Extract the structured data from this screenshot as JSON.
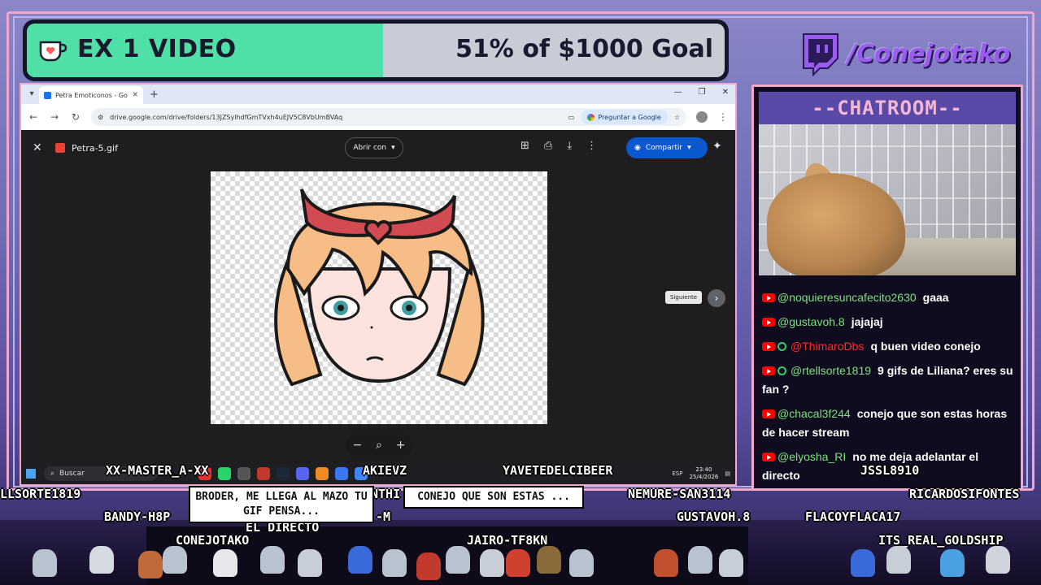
{
  "goal": {
    "title": "EX 1 VIDEO",
    "progress_text": "51% of $1000 Goal",
    "progress": 0.51,
    "colors": {
      "fill": "#4fe0a8",
      "track": "#c9cbd6"
    }
  },
  "twitch": {
    "name": "/Conejotako",
    "icon": "twitch-icon",
    "color": "#9a5cf0"
  },
  "browser": {
    "tab_title": "Petra Emoticonos - Google Drive",
    "url": "drive.google.com/drive/folders/13JZSylhdfGmTVxh4uEJV5C8VbUmBVAq",
    "ask_google": "Preguntar a Google",
    "viewer": {
      "filename": "Petra-5.gif",
      "open_with": "Abrir con",
      "share": "Compartir",
      "next_tooltip": "Siguiente"
    },
    "taskbar": {
      "search": "Buscar",
      "lang": "ESP",
      "time": "23:40",
      "date": "25/4/2026"
    }
  },
  "chat": {
    "header": "--CHATROOM--",
    "messages": [
      {
        "user": "@noquieresuncafecito2630",
        "user_color": "#7ee07e",
        "text": "gaaa",
        "badge": false
      },
      {
        "user": "@gustavoh.8",
        "user_color": "#7ee07e",
        "text": "jajajaj",
        "badge": false
      },
      {
        "user": "@ThimaroDbs",
        "user_color": "#ff2a2a",
        "text": "q buen video conejo",
        "badge": true
      },
      {
        "user": "@rtellsorte1819",
        "user_color": "#7ee07e",
        "text": "9 gifs de Liliana? eres su fan ?",
        "badge": true
      },
      {
        "user": "@chacal3f244",
        "user_color": "#7ee07e",
        "text": "conejo que son estas horas de hacer stream",
        "badge": false
      },
      {
        "user": "@elyosha_RI",
        "user_color": "#7ee07e",
        "text": "no me deja adelantar el directo",
        "badge": false
      }
    ]
  },
  "overlay_names": {
    "xx_master": "XX-MASTER_A-XX",
    "akievz": "AKIEVZ",
    "yavete": "YAVETEDELCIBEER",
    "jssl": "JSSL8910",
    "llsorte": "LLSORTE1819",
    "nemure": "NEMURE-SAN3114",
    "ricardo": "RICARDOSIFONTES",
    "bandy": "BANDY-H8P",
    "m_frag": "-M",
    "nthi_frag": "NTHI",
    "gustavoh": "GUSTAVOH.8",
    "flacoy": "FLACOYFLACA17",
    "conejotako": "CONEJOTAKO",
    "jairo": "JAIRO-TF8KN",
    "its_real": "ITS_REAL_GOLDSHIP",
    "directo_frag": "EL DIRECTO"
  },
  "bubbles": {
    "broder": "BRODER, ME LLEGA AL MAZO TU GIF PENSA...",
    "conejo": "CONEJO QUE SON ESTAS ..."
  }
}
